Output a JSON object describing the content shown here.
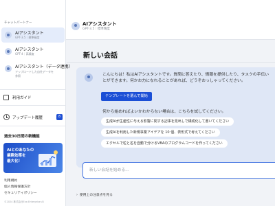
{
  "header": {
    "title": "AIアシスタント",
    "subtitle": "GPT-3.5｜標準精度"
  },
  "sidebar": {
    "section_heading": "チャットパートナー",
    "partners": [
      {
        "title": "AIアシスタント",
        "subtitle": "GPT-3.5｜標準精度",
        "active": true
      },
      {
        "title": "AIアシスタント",
        "subtitle": "GPT-4｜高精度",
        "active": false
      },
      {
        "title": "AIアシスタント（データ連携）",
        "subtitle_lines": [
          "アップロードした自社データを",
          "参照"
        ],
        "active": false
      }
    ],
    "usage_guide_label": "利用ガイド",
    "update_history_label": "アップデート履歴",
    "update_badge_count": "8",
    "timeline_label": "過去30日間の新機能",
    "banner_text": "AIとのあなたの\n業務効率を\n最大化！",
    "footer_links": [
      "利用規約",
      "個人情報保護方針",
      "セキュリティポリシー"
    ],
    "copyright": "©2024 株式会社Exa Enterprise AI"
  },
  "main": {
    "page_title": "新しい会話",
    "greeting": "こんにちは！私はAIアシスタントです。質問に答えたり、情報を提供したり、タスクの手伝い\nとができます。何かお力になれることがあれば、どうぞおっしゃってください。",
    "template_button_label": "テンプレートを選んで開始",
    "hint_text": "何から始めればよいかわからない場合は、こちらを試してください。",
    "suggestions": [
      "生成AIが生産性に与える影響に関する記事を見出しで構成化して書いてください",
      "生成AIを利用した新規事業アイデアを 10 個、表形式で考えてください",
      "エクセルで粒と名を自動で分けるVBAのプログラムコードを作ってください"
    ],
    "input_placeholder": "新しい会話を始める...",
    "notes_label": "使用上の注意点を見る"
  },
  "colors": {
    "accent": "#1b4fd6",
    "active_item": "#e4ecfb",
    "bubble": "#dfe7f6"
  },
  "icons": {
    "partner": "user-avatar-icon",
    "guide": "book-icon",
    "history": "clock-icon",
    "notes": "chevron-right-icon"
  }
}
